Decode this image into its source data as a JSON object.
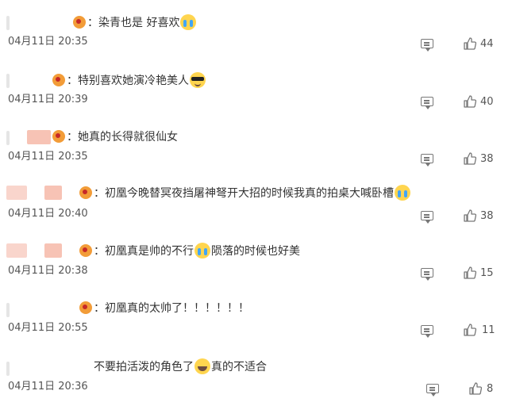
{
  "colors": {
    "text": "#333333",
    "meta": "#555555",
    "icon": "#777777",
    "blur_pink": "#f7c3b5",
    "blur_grey": "#e5e5e5"
  },
  "comments": [
    {
      "text_before": "：染青也是 好喜欢",
      "emoji": "cry-emoji",
      "text_after": "",
      "time": "04月11日 20:35",
      "likes": "44"
    },
    {
      "text_before": "：特别喜欢她演冷艳美人",
      "emoji": "cool-emoji",
      "text_after": "",
      "time": "04月11日 20:39",
      "likes": "40"
    },
    {
      "text_before": "：她真的长得就很仙女",
      "emoji": "",
      "text_after": "",
      "time": "04月11日 20:35",
      "likes": "38"
    },
    {
      "text_before": "：初凰今晚替冥夜挡屠神弩开大招的时候我真的拍桌大喊卧槽",
      "emoji": "cry-emoji",
      "text_after": "",
      "time": "04月11日 20:40",
      "likes": "38"
    },
    {
      "text_before": "：初凰真是帅的不行",
      "emoji": "cry-emoji",
      "text_after": "陨落的时候也好美",
      "time": "04月11日 20:38",
      "likes": "15"
    },
    {
      "text_before": "：初凰真的太帅了！！！！！！",
      "emoji": "",
      "text_after": "",
      "time": "04月11日 20:55",
      "likes": "11"
    },
    {
      "text_before": "不要拍活泼的角色了",
      "emoji": "laugh-emoji",
      "text_after": "真的不适合",
      "time": "04月11日 20:36",
      "likes": "8"
    }
  ]
}
